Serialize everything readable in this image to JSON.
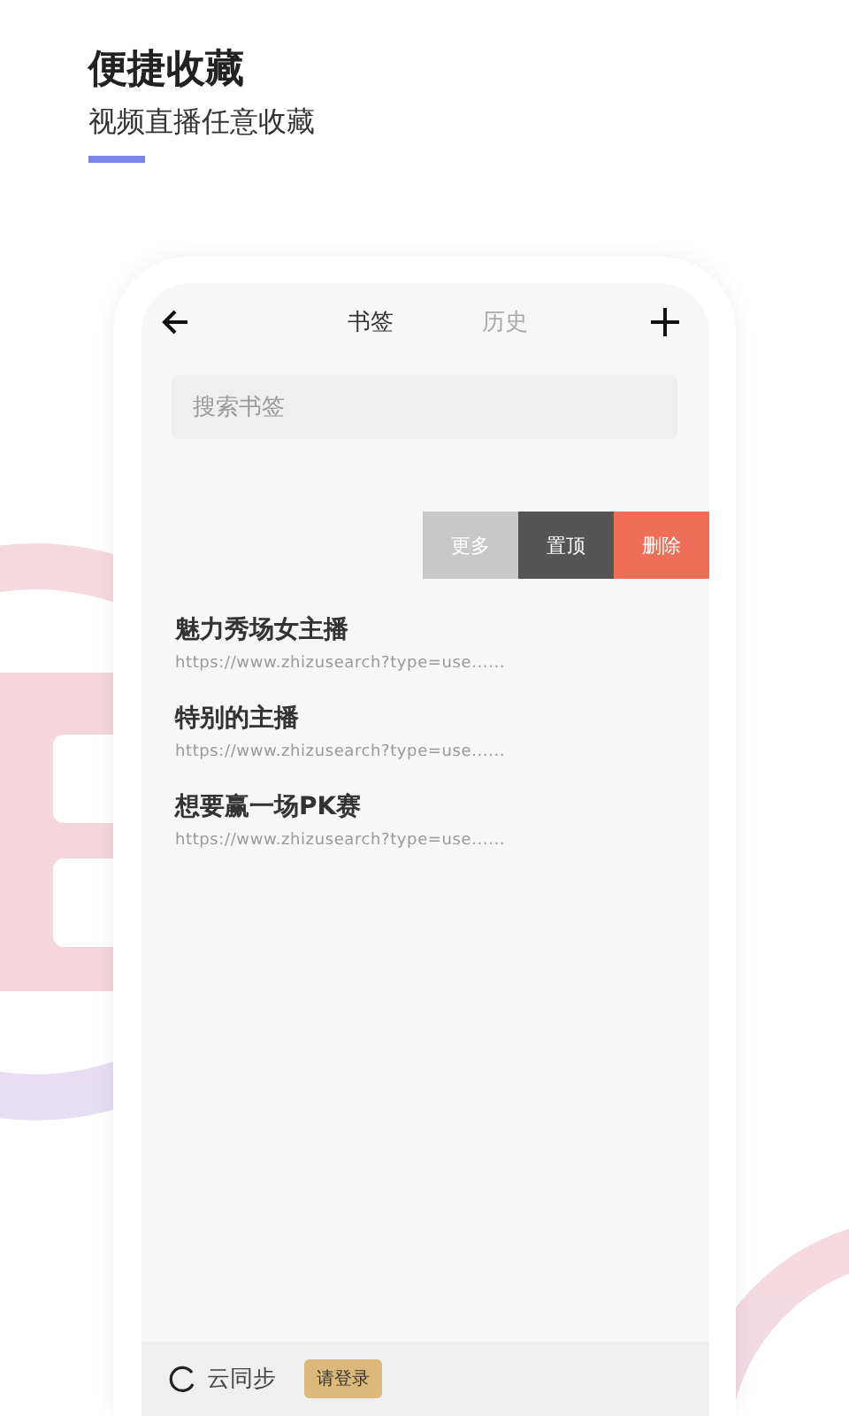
{
  "header": {
    "title": "便捷收藏",
    "subtitle": "视频直播任意收藏"
  },
  "nav": {
    "tabs": [
      {
        "label": "书签",
        "selected": true
      },
      {
        "label": "历史",
        "selected": false
      }
    ]
  },
  "search": {
    "placeholder": "搜索书签"
  },
  "swipe_actions": [
    {
      "label": "更多",
      "color": "#c8c8c8"
    },
    {
      "label": "置顶",
      "color": "#555555"
    },
    {
      "label": "删除",
      "color": "#ee6e58"
    }
  ],
  "bookmarks": [
    {
      "title": "魅力秀场女主播",
      "url": "https://www.zhizusearch?type=use......"
    },
    {
      "title": "特别的主播",
      "url": "https://www.zhizusearch?type=use......"
    },
    {
      "title": "想要赢一场PK赛",
      "url": "https://www.zhizusearch?type=use......"
    }
  ],
  "footer": {
    "sync_label": "云同步",
    "login_badge": "请登录"
  }
}
